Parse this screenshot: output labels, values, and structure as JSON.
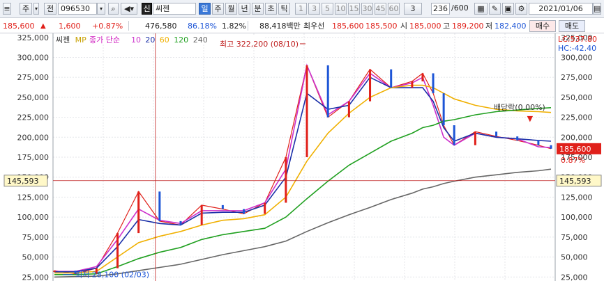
{
  "toolbar": {
    "menu_label": "주",
    "jeon_label": "전",
    "code": "096530",
    "market_badge": "신",
    "stock_name": "씨젠",
    "period_tabs": [
      "일",
      "주",
      "월",
      "년",
      "분",
      "초",
      "틱"
    ],
    "active_period": "일",
    "minute_options": [
      "1",
      "3",
      "5",
      "10",
      "15",
      "30",
      "45",
      "60"
    ],
    "interval_value": "3",
    "count_value": "236",
    "count_total": "/600",
    "date_value": "2021/01/06",
    "icons": [
      "dropdown-arrow-icon",
      "search-icon",
      "sound-icon",
      "grid-icon",
      "draw-icon",
      "save-icon",
      "settings-icon",
      "calendar-icon"
    ]
  },
  "quote": {
    "price": "185,600",
    "change": "1,600",
    "change_pct": "+0.87%",
    "volume": "476,580",
    "turnover_pct": "86.18%",
    "rate": "1.82%",
    "amount": "88,418백만",
    "quote_label": "최우선",
    "ask": "185,600",
    "bid": "185,500",
    "open_label": "시",
    "open": "185,000",
    "high_label": "고",
    "high": "189,200",
    "low_label": "저",
    "low": "182,400",
    "buy_label": "매수",
    "sell_label": "매도"
  },
  "chart_data": {
    "type": "line",
    "title": "씨젠",
    "legend": [
      {
        "label": "씨젠",
        "color": "#333333"
      },
      {
        "label": "MP",
        "color": "#c8a000"
      },
      {
        "label": "종가 단순",
        "color": "#d020c0"
      },
      {
        "label": "10",
        "color": "#cc30cc"
      },
      {
        "label": "20",
        "color": "#1a2fa8"
      },
      {
        "label": "60",
        "color": "#f0b000"
      },
      {
        "label": "120",
        "color": "#20a020"
      },
      {
        "label": "240",
        "color": "#666666"
      }
    ],
    "y_ticks": [
      "325,000",
      "300,000",
      "275,000",
      "250,000",
      "225,000",
      "200,000",
      "175,000",
      "150,000",
      "125,000",
      "100,000",
      "75,000",
      "50,000",
      "25,000"
    ],
    "ylim": [
      20000,
      330000
    ],
    "x": [
      0,
      10,
      20,
      30,
      40,
      50,
      60,
      70,
      80,
      90,
      100,
      110,
      120,
      130,
      140,
      150,
      160,
      170,
      175,
      180,
      185,
      190,
      200,
      210,
      220,
      230,
      236
    ],
    "series": [
      {
        "name": "씨젠",
        "values": [
          33000,
          29000,
          36000,
          80000,
          132000,
          95000,
          90000,
          115000,
          110000,
          104000,
          118000,
          175000,
          290000,
          225000,
          245000,
          285000,
          262000,
          270000,
          280000,
          255000,
          215000,
          190000,
          207000,
          201000,
          196000,
          190000,
          185600
        ]
      },
      {
        "name": "10",
        "values": [
          32000,
          32000,
          38000,
          72000,
          110000,
          96000,
          92000,
          108000,
          108000,
          108000,
          118000,
          160000,
          290000,
          228000,
          245000,
          280000,
          262000,
          268000,
          275000,
          240000,
          200000,
          190000,
          205000,
          200000,
          198000,
          188000,
          187000
        ]
      },
      {
        "name": "20",
        "values": [
          31500,
          31500,
          36000,
          63000,
          97000,
          92000,
          90000,
          105000,
          106000,
          106000,
          115000,
          150000,
          255000,
          235000,
          240000,
          275000,
          262000,
          262000,
          262000,
          245000,
          212000,
          195000,
          205000,
          200000,
          198000,
          196000,
          195000
        ]
      },
      {
        "name": "60",
        "values": [
          30000,
          30000,
          32000,
          50000,
          68000,
          76000,
          82000,
          90000,
          96000,
          98000,
          103000,
          125000,
          170000,
          205000,
          230000,
          250000,
          262000,
          265000,
          265000,
          262000,
          255000,
          248000,
          240000,
          235000,
          233000,
          232000,
          231000
        ]
      },
      {
        "name": "120",
        "values": [
          28000,
          28000,
          29000,
          38000,
          48000,
          56000,
          62000,
          72000,
          78000,
          82000,
          86000,
          100000,
          123000,
          145000,
          165000,
          180000,
          195000,
          205000,
          212000,
          215000,
          220000,
          222000,
          228000,
          232000,
          234000,
          236000,
          237000
        ]
      },
      {
        "name": "240",
        "values": [
          25000,
          25500,
          26000,
          29000,
          33000,
          37000,
          41000,
          47000,
          53000,
          58000,
          63000,
          70000,
          82000,
          93000,
          103000,
          112000,
          122000,
          130000,
          135000,
          138000,
          142000,
          145000,
          150000,
          153000,
          156000,
          158000,
          160000
        ]
      }
    ],
    "annotations": [
      {
        "text": "최고 322,200 (08/10)",
        "x": 118,
        "y": 322200
      },
      {
        "text": "최저 28,100 (02/03)",
        "x": 4,
        "y": 28100
      },
      {
        "text": "배당락(0.00%)",
        "x": 226,
        "y": 210000
      }
    ],
    "current_label": "185,600",
    "current_pct": "0.87%",
    "crosshair_label": "145,593",
    "crosshair_value": 145593,
    "crosshair_x": 48,
    "lc_label": "LC:537.80",
    "hc_label": "HC:-42.40"
  }
}
